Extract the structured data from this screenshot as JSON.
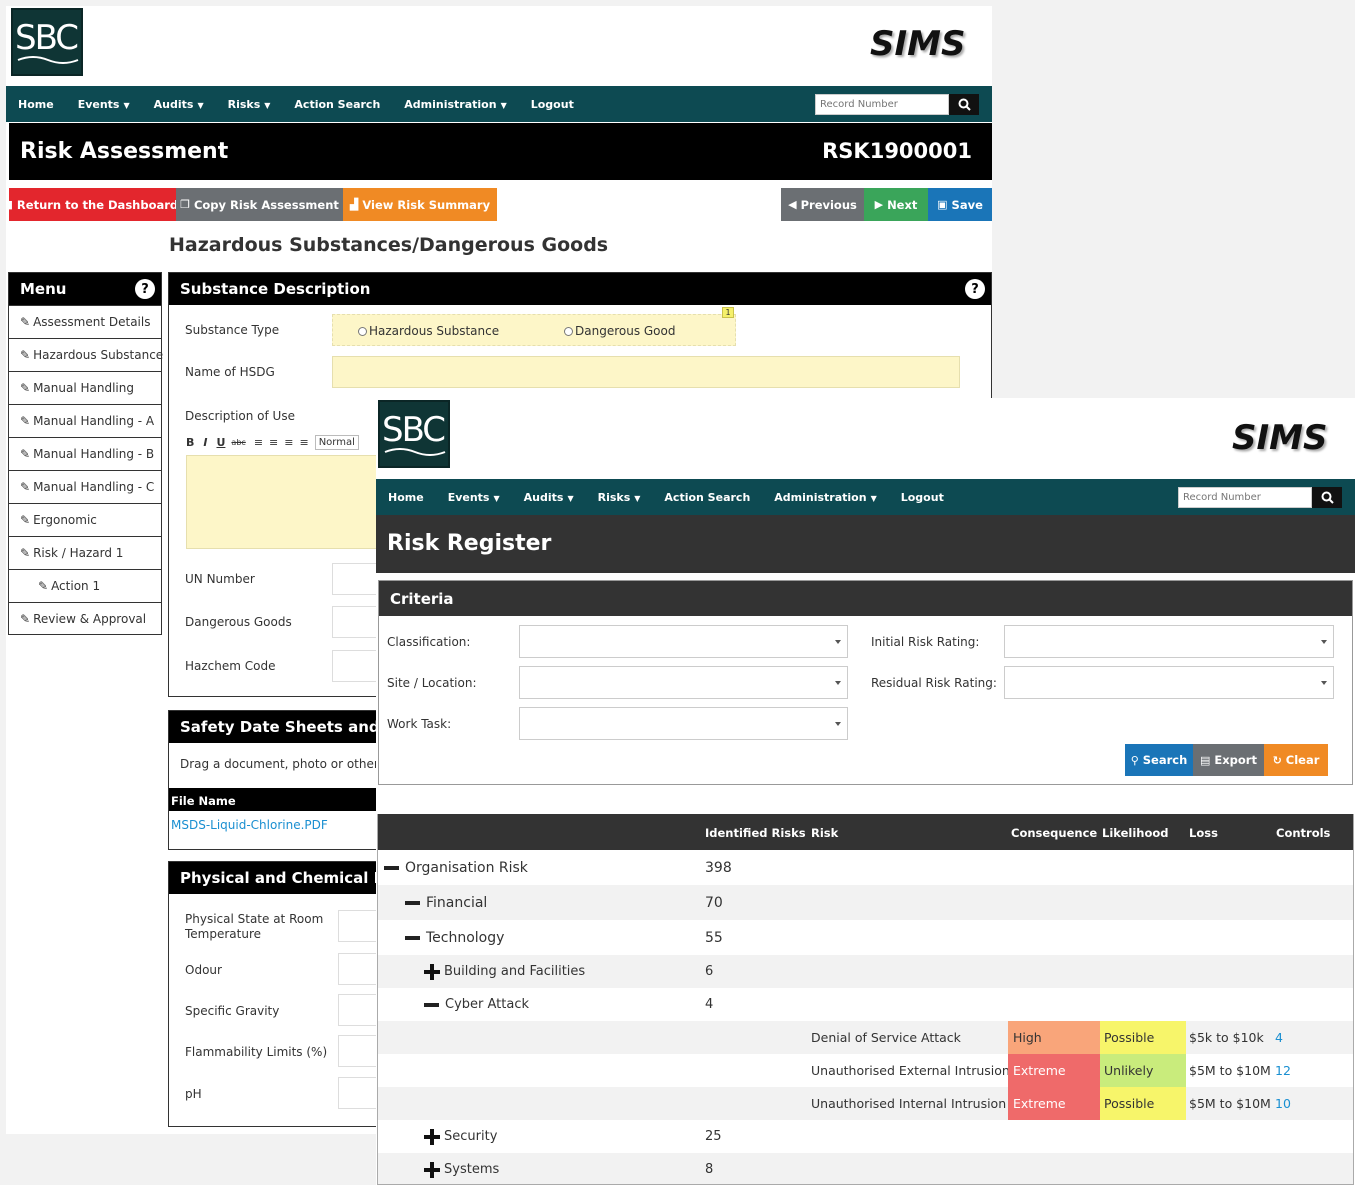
{
  "brand": {
    "logo_text": "SBC",
    "app_name": "SIMS"
  },
  "nav": {
    "items": [
      {
        "label": "Home",
        "dropdown": false
      },
      {
        "label": "Events",
        "dropdown": true
      },
      {
        "label": "Audits",
        "dropdown": true
      },
      {
        "label": "Risks",
        "dropdown": true
      },
      {
        "label": "Action Search",
        "dropdown": false
      },
      {
        "label": "Administration",
        "dropdown": true
      },
      {
        "label": "Logout",
        "dropdown": false
      }
    ],
    "search_placeholder": "Record Number"
  },
  "risk_assessment": {
    "title": "Risk Assessment",
    "record_number": "RSK1900001",
    "buttons": {
      "return": "Return to the Dashboard",
      "copy": "Copy Risk Assessment",
      "view_summary": "View Risk Summary",
      "previous": "Previous",
      "next": "Next",
      "save": "Save"
    },
    "section_title": "Hazardous Substances/Dangerous Goods",
    "menu": {
      "title": "Menu",
      "help": "?",
      "items": [
        {
          "label": "Assessment Details",
          "sub": false
        },
        {
          "label": "Hazardous Substance",
          "sub": false
        },
        {
          "label": "Manual Handling",
          "sub": false
        },
        {
          "label": "Manual Handling - A",
          "sub": false
        },
        {
          "label": "Manual Handling - B",
          "sub": false
        },
        {
          "label": "Manual Handling - C",
          "sub": false
        },
        {
          "label": "Ergonomic",
          "sub": false
        },
        {
          "label": "Risk / Hazard 1",
          "sub": false
        },
        {
          "label": "Action 1",
          "sub": true
        },
        {
          "label": "Review & Approval",
          "sub": false
        }
      ]
    },
    "substance": {
      "title": "Substance Description",
      "help": "?",
      "substance_type_label": "Substance Type",
      "radio_options": [
        "Hazardous Substance",
        "Dangerous Good"
      ],
      "badge": "1",
      "name_label": "Name of HSDG",
      "description_label": "Description of Use",
      "editor_toolbar": [
        "B",
        "I",
        "U",
        "abc",
        "≡",
        "≡",
        "≡",
        "≡"
      ],
      "editor_format": "Normal",
      "un_label": "UN Number",
      "dg_label": "Dangerous Goods",
      "hazchem_label": "Hazchem Code"
    },
    "sds": {
      "title": "Safety Date Sheets and Re",
      "drag_text": "Drag a document, photo or other file",
      "file_col": "File Name",
      "files": [
        "MSDS-Liquid-Chlorine.PDF"
      ]
    },
    "physical": {
      "title": "Physical and Chemical Pro",
      "fields": [
        "Physical State at Room Temperature",
        "Odour",
        "Specific Gravity",
        "Flammability Limits (%)",
        "pH"
      ]
    }
  },
  "risk_register": {
    "title": "Risk Register",
    "criteria": {
      "title": "Criteria",
      "classification": "Classification:",
      "site": "Site / Location:",
      "work_task": "Work Task:",
      "initial": "Initial Risk Rating:",
      "residual": "Residual Risk Rating:",
      "search": "Search",
      "export": "Export",
      "clear": "Clear"
    },
    "columns": [
      "Identified Risks",
      "Risk",
      "Consequence",
      "Likelihood",
      "Loss",
      "Controls"
    ],
    "rows": [
      {
        "name": "Organisation Risk",
        "count": "398",
        "expander": "minus",
        "level": 0
      },
      {
        "name": "Financial",
        "count": "70",
        "expander": "minus",
        "level": 1
      },
      {
        "name": "Technology",
        "count": "55",
        "expander": "minus",
        "level": 1
      },
      {
        "name": "Building and Facilities",
        "count": "6",
        "expander": "plus",
        "level": 2
      },
      {
        "name": "Cyber Attack",
        "count": "4",
        "expander": "minus",
        "level": 2
      },
      {
        "risk": "Denial of Service Attack",
        "consequence": "High",
        "likelihood": "Possible",
        "loss": "$5k to $10k",
        "controls": "4"
      },
      {
        "risk": "Unauthorised External Intrusion",
        "consequence": "Extreme",
        "likelihood": "Unlikely",
        "loss": "$5M to $10M",
        "controls": "12"
      },
      {
        "risk": "Unauthorised Internal Intrusion",
        "consequence": "Extreme",
        "likelihood": "Possible",
        "loss": "$5M to $10M",
        "controls": "10"
      },
      {
        "name": "Security",
        "count": "25",
        "expander": "plus",
        "level": 2
      },
      {
        "name": "Systems",
        "count": "8",
        "expander": "plus",
        "level": 2
      }
    ],
    "colors": {
      "High": "#f9a57a",
      "Extreme": "#ef6a6a",
      "Possible": "#f7f56a",
      "Unlikely": "#c9ec7c"
    }
  },
  "colors": {
    "nav_bg": "#0d4a52",
    "red_button": "#e3262d",
    "grey_button": "#6b6f73",
    "orange_button": "#f08a24",
    "green_button": "#3aa55a",
    "blue_button": "#1a75b8",
    "link": "#1a8fd1"
  }
}
